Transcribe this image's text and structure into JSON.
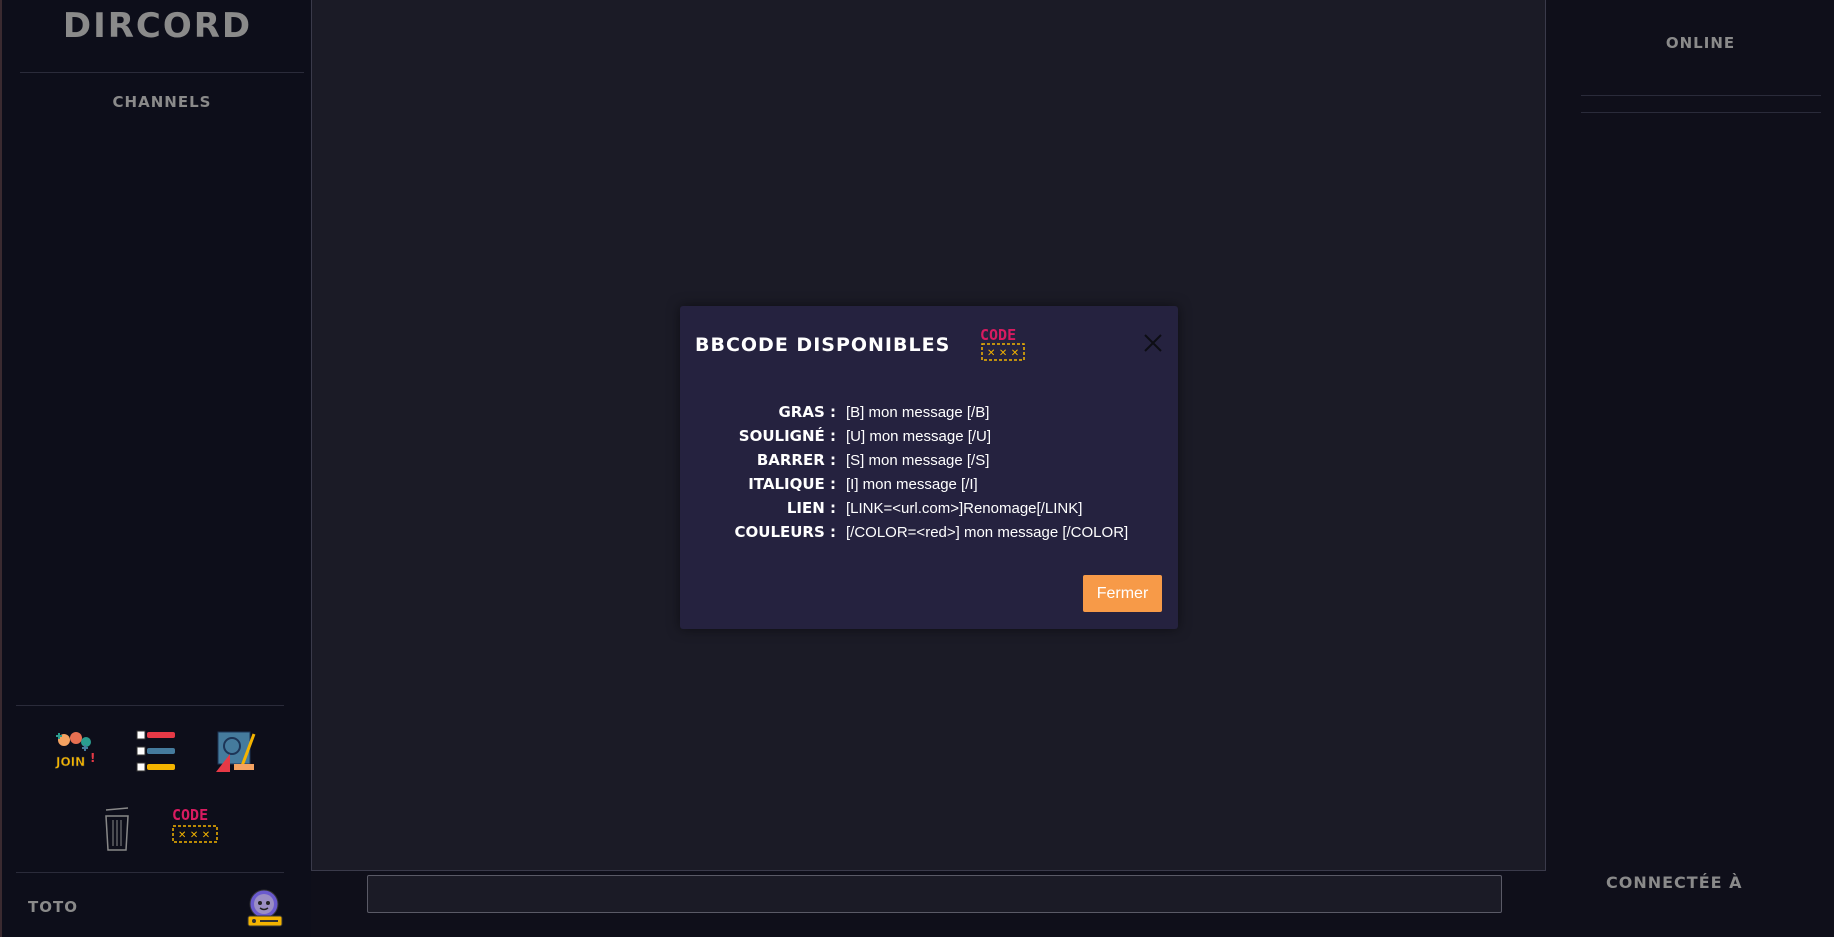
{
  "app": {
    "title": "DIRCORD"
  },
  "left_sidebar": {
    "channels_heading": "CHANNELS",
    "tools": [
      {
        "icon": "join-icon"
      },
      {
        "icon": "list-icon"
      },
      {
        "icon": "edit-icon"
      },
      {
        "icon": "trash-icon"
      },
      {
        "icon": "code-icon",
        "text": "CODE"
      }
    ],
    "user": {
      "name": "TOTO",
      "avatar_icon": "avatar-icon"
    }
  },
  "right_sidebar": {
    "online_heading": "ONLINE",
    "connected_label": "CONNECTÉE À"
  },
  "chat": {
    "input_value": "",
    "input_placeholder": ""
  },
  "modal": {
    "title": "BBCODE DISPONIBLES",
    "code_icon_text": "CODE",
    "rows": [
      {
        "label": "GRAS :",
        "value": "[B] mon message [/B]"
      },
      {
        "label": "SOULIGNÉ :",
        "value": "[U] mon message [/U]"
      },
      {
        "label": "BARRER :",
        "value": "[S] mon message [/S]"
      },
      {
        "label": "ITALIQUE :",
        "value": "[I] mon message [/I]"
      },
      {
        "label": "LIEN :",
        "value": "[LINK=<url.com>]Renomage[/LINK]"
      },
      {
        "label": "COULEURS :",
        "value": "[/COLOR=<red>] mon message [/COLOR]"
      }
    ],
    "close_label": "Fermer"
  },
  "colors": {
    "accent": "#f79a48",
    "modal_bg": "#25223f",
    "chat_bg": "#1b1b26",
    "sidebar_bg": "#0d0e1a",
    "code_pink": "#d81b60",
    "code_yellow": "#f4b400"
  }
}
